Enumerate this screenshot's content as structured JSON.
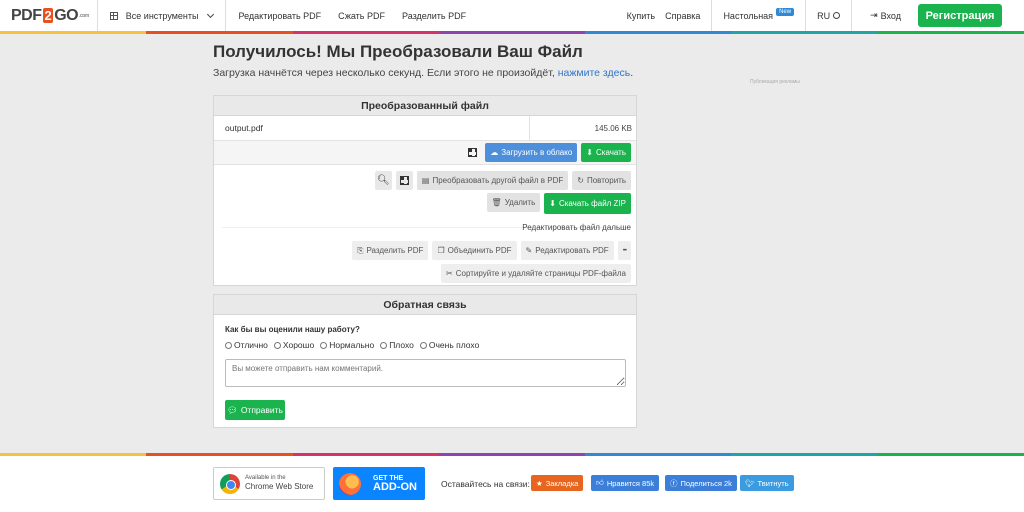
{
  "header": {
    "logo": {
      "pdf": "PDF",
      "two": "2",
      "go": "GO",
      "small": ".com"
    },
    "all_tools": "Все инструменты",
    "nav": [
      "Редактировать PDF",
      "Сжать PDF",
      "Разделить PDF"
    ],
    "buy": "Купить",
    "help": "Справка",
    "desktop": "Настольная",
    "new_badge": "New",
    "lang": "RU",
    "login": "Вход",
    "register": "Регистрация"
  },
  "rainbow_colors": [
    "#f6c23e",
    "#e8501f",
    "#d6336c",
    "#8e44ad",
    "#2f89d4",
    "#20a4a4",
    "#1ab34e"
  ],
  "main": {
    "title": "Получилось! Мы Преобразовали Ваш Файл",
    "subtitle_prefix": "Загрузка начнётся через несколько секунд. Если этого не произойдёт,",
    "subtitle_link": "нажмите здесь",
    "subtitle_suffix": ".",
    "ad_label": "Публикация рекламы"
  },
  "converted": {
    "heading": "Преобразованный файл",
    "file_name": "output.pdf",
    "file_size": "145.06 KB",
    "upload_cloud": "Загрузить в облако",
    "download": "Скачать",
    "convert_another": "Преобразовать другой файл в PDF",
    "repeat": "Повторить",
    "delete": "Удалить",
    "download_zip": "Скачать файл ZIP",
    "edit_further": "Редактировать файл дальше",
    "split": "Разделить PDF",
    "merge": "Объединить PDF",
    "edit": "Редактировать PDF",
    "more": "•••",
    "sort": "Сортируйте и удаляйте страницы PDF-файла"
  },
  "feedback": {
    "heading": "Обратная связь",
    "question": "Как бы вы оценили нашу работу?",
    "options": [
      "Отлично",
      "Хорошо",
      "Нормально",
      "Плохо",
      "Очень плохо"
    ],
    "placeholder": "Вы можете отправить нам комментарий.",
    "send": "Отправить"
  },
  "footer": {
    "chrome_small": "Available in the",
    "chrome_big": "Chrome Web Store",
    "ff_small": "GET THE",
    "ff_big": "ADD-ON",
    "stay": "Оставайтесь на связи:",
    "bookmark": "Закладка",
    "like": "Нравится 85k",
    "share": "Поделиться 2k",
    "tweet": "Твитнуть",
    "colors": {
      "bookmark": "#e8651f",
      "like": "#3b7fd9",
      "share": "#3b7fd9",
      "tweet": "#3b9be0"
    }
  }
}
